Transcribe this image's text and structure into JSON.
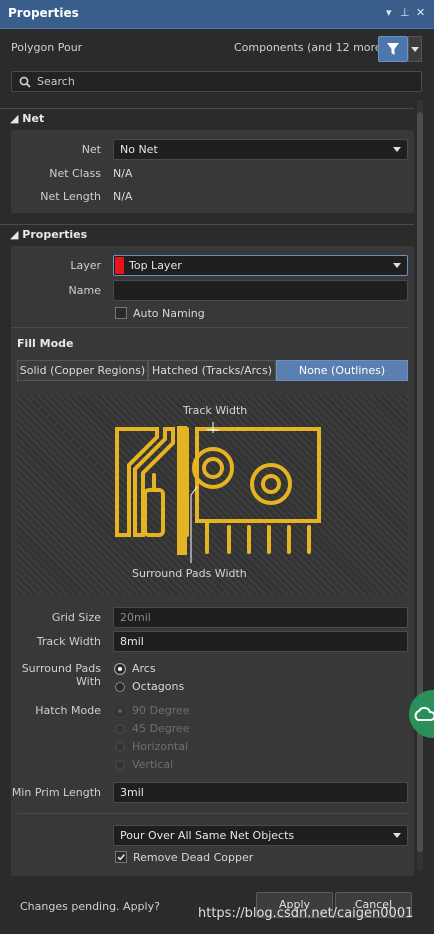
{
  "window": {
    "title": "Properties"
  },
  "header": {
    "object_type": "Polygon Pour",
    "filter_label": "Components (and 12 more)"
  },
  "search": {
    "placeholder": "Search"
  },
  "net_section": {
    "title": "Net",
    "net_label": "Net",
    "net_value": "No Net",
    "net_class_label": "Net Class",
    "net_class_value": "N/A",
    "net_length_label": "Net Length",
    "net_length_value": "N/A"
  },
  "properties_section": {
    "title": "Properties",
    "layer_label": "Layer",
    "layer_value": "Top Layer",
    "layer_color": "#e8141a",
    "name_label": "Name",
    "name_value": "",
    "auto_naming_label": "Auto Naming",
    "auto_naming_checked": false
  },
  "fill_mode": {
    "title": "Fill Mode",
    "options": [
      "Solid (Copper Regions)",
      "Hatched (Tracks/Arcs)",
      "None (Outlines)"
    ],
    "selected": "None (Outlines)",
    "diagram": {
      "track_width_label": "Track Width",
      "surround_pads_label": "Surround Pads Width",
      "trace_color": "#e6b422"
    }
  },
  "settings": {
    "grid_size_label": "Grid Size",
    "grid_size_value": "20mil",
    "track_width_label": "Track Width",
    "track_width_value": "8mil",
    "surround_pads_label_1": "Surround Pads",
    "surround_pads_label_2": "With",
    "surround_options": [
      "Arcs",
      "Octagons"
    ],
    "surround_selected": "Arcs",
    "hatch_mode_label": "Hatch Mode",
    "hatch_options": [
      "90 Degree",
      "45 Degree",
      "Horizontal",
      "Vertical"
    ],
    "hatch_selected": "90 Degree",
    "min_prim_label": "Min Prim Length",
    "min_prim_value": "3mil"
  },
  "pour_over": {
    "value": "Pour Over All Same Net Objects",
    "remove_dead_label": "Remove Dead Copper",
    "remove_dead_checked": true
  },
  "footer": {
    "pending_text": "Changes pending. Apply?",
    "apply_label": "Apply",
    "cancel_label": "Cancel"
  },
  "watermark": {
    "text": "https://blog.csdn.net/caigen0001"
  },
  "colors": {
    "accent": "#3a5e8c",
    "selected_segment": "#5b7fb0",
    "background": "#2b2b2b"
  }
}
